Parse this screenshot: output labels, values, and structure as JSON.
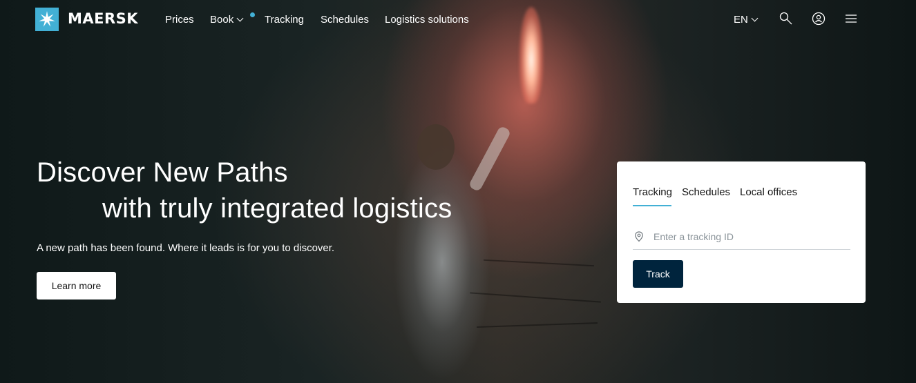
{
  "brand": {
    "name": "MAERSK",
    "logo_color": "#42b0d5",
    "logo_icon": "seven-point-star-icon"
  },
  "nav": {
    "links": [
      "Prices",
      "Book",
      "Tracking",
      "Schedules",
      "Logistics solutions"
    ],
    "language": "EN",
    "icons": [
      "search-icon",
      "user-icon",
      "menu-icon"
    ]
  },
  "hero": {
    "headline_line1": "Discover New Paths",
    "headline_line2": "with truly integrated logistics",
    "subheading": "A new path has been found. Where it leads is for you to discover.",
    "cta_label": "Learn more"
  },
  "tracking_card": {
    "tabs": [
      "Tracking",
      "Schedules",
      "Local offices"
    ],
    "active_tab": "Tracking",
    "input_placeholder": "Enter a tracking ID",
    "input_value": "",
    "button_label": "Track",
    "accent_color": "#42b0d5",
    "button_color": "#00243d"
  }
}
